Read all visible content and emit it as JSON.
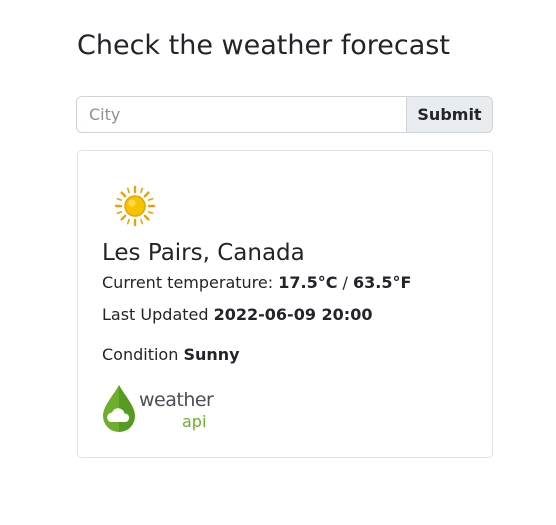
{
  "page": {
    "title": "Check the weather forecast"
  },
  "search": {
    "placeholder": "City",
    "value": "",
    "submit_label": "Submit"
  },
  "result": {
    "location": "Les Pairs, Canada",
    "temperature_label": "Current temperature: ",
    "temp_c": "17.5°C",
    "temp_sep": " / ",
    "temp_f": "63.5°F",
    "updated_label": "Last Updated ",
    "updated_value": "2022-06-09 20:00",
    "condition_label": "Condition ",
    "condition_value": "Sunny",
    "condition_icon": "sun-icon"
  },
  "logo": {
    "word1": "weather",
    "word2": "api",
    "icon": "weatherapi-drop-cloud-icon"
  },
  "colors": {
    "sun_core": "#f5c400",
    "sun_rays": "#f0a000",
    "logo_green": "#6fae2c",
    "logo_dark_green": "#3f8d1d"
  }
}
